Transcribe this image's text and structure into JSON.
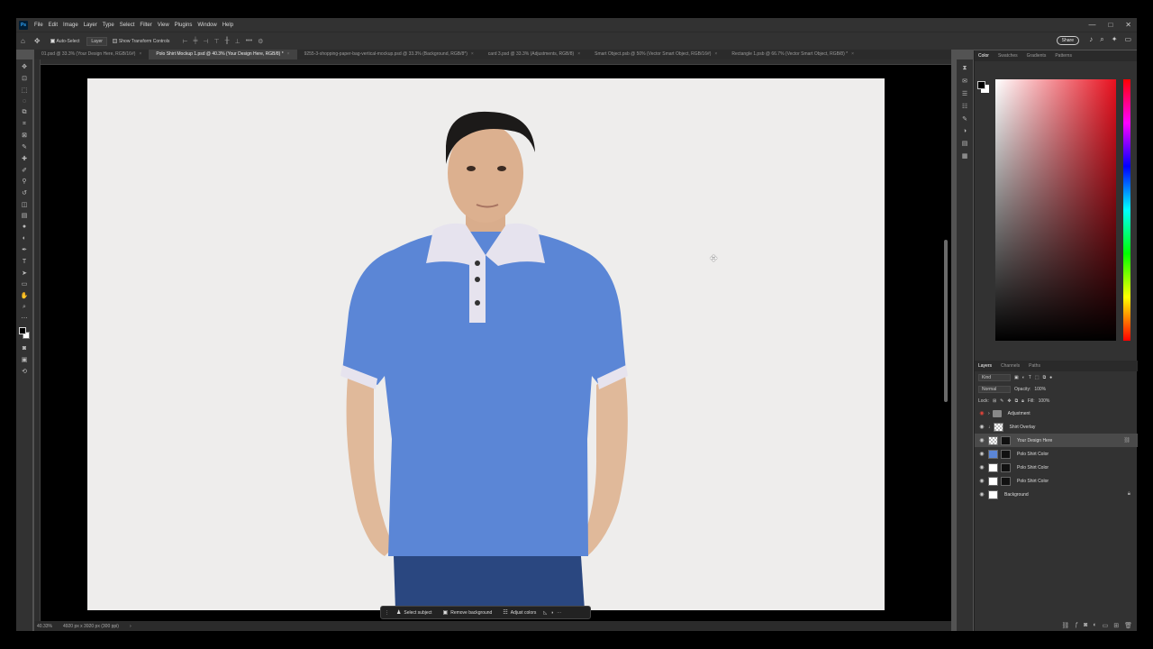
{
  "app": {
    "logo": "Ps",
    "menu": [
      "File",
      "Edit",
      "Image",
      "Layer",
      "Type",
      "Select",
      "Filter",
      "View",
      "Plugins",
      "Window",
      "Help"
    ],
    "window_controls": [
      "—",
      "□",
      "✕"
    ]
  },
  "options": {
    "auto_select_label": "Auto-Select",
    "auto_select_checked": true,
    "layer_select": "Layer",
    "transform_label": "Show Transform Controls",
    "transform_checked": false,
    "more": "•••",
    "share": "Share"
  },
  "tabs": [
    {
      "label": "01.psd @ 33.3% (Your Design Here, RGB/16#)",
      "active": false
    },
    {
      "label": "Polo Shirt Mockup 1.psd @ 40.3% (Your Design Here, RGB/8) *",
      "active": true
    },
    {
      "label": "9255-3-shopping-paper-bag-vertical-mockup.psd @ 33.3% (Background, RGB/8*)",
      "active": false
    },
    {
      "label": "card 3.psd @ 33.3% (Adjustments, RGB/8)",
      "active": false
    },
    {
      "label": "Smart Object.psb @ 50% (Vector Smart Object, RGB/16#)",
      "active": false
    },
    {
      "label": "Rectangle 1.psb @ 66.7% (Vector Smart Object, RGB/8) *",
      "active": false
    }
  ],
  "status": {
    "zoom": "40.33%",
    "doc_size": "4920 px x 3920 px (300 ppi)"
  },
  "context_bar": {
    "select_subject": "Select subject",
    "remove_background": "Remove background",
    "adjust_colors": "Adjust colors"
  },
  "color_panel": {
    "tabs": [
      "Color",
      "Swatches",
      "Gradients",
      "Patterns"
    ],
    "hue_color": "#e8101e"
  },
  "layers_panel": {
    "tabs": [
      "Layers",
      "Channels",
      "Paths"
    ],
    "kind": "Kind",
    "blend_mode": "Normal",
    "opacity_label": "Opacity:",
    "opacity": "100%",
    "lock_label": "Lock:",
    "fill_label": "Fill:",
    "fill": "100%",
    "layers": [
      {
        "name": "Adjustment",
        "type": "folder",
        "eye": "red"
      },
      {
        "name": "Shirt Overlay",
        "type": "check"
      },
      {
        "name": "Your Design Here",
        "type": "check",
        "selected": true
      },
      {
        "name": "Polo Shirt Color",
        "type": "blue"
      },
      {
        "name": "Polo Shirt Color",
        "type": "white"
      },
      {
        "name": "Polo Shirt Color",
        "type": "white"
      },
      {
        "name": "Background",
        "type": "white",
        "locked": true
      }
    ]
  },
  "photo": {
    "shirt_color": "#5b86d6",
    "collar_color": "#e6e3ee",
    "jeans_color": "#2a4780",
    "backdrop": "#eeedec"
  }
}
